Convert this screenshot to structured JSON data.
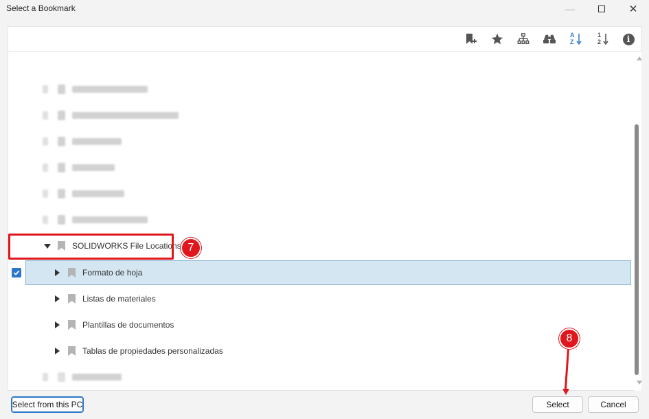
{
  "window": {
    "title": "Select a Bookmark",
    "minimize_label": "—",
    "close_label": "✕"
  },
  "toolbar": {
    "icons": [
      "add-bookmark-icon",
      "star-icon",
      "hierarchy-icon",
      "binoculars-icon",
      "sort-alpha-icon",
      "sort-numeric-icon",
      "info-icon"
    ],
    "sort_alpha_a": "A",
    "sort_alpha_z": "Z",
    "sort_num_1": "1",
    "sort_num_2": "2",
    "info_glyph": "i",
    "accent_color": "#3b7fd1"
  },
  "tree": {
    "group": {
      "label": "SOLIDWORKS File Locations",
      "expanded": true
    },
    "children": [
      {
        "label": "Formato de hoja",
        "selected": true,
        "checked": true
      },
      {
        "label": "Listas de materiales",
        "selected": false
      },
      {
        "label": "Plantillas de documentos",
        "selected": false
      },
      {
        "label": "Tablas de propiedades personalizadas",
        "selected": false
      }
    ]
  },
  "annotations": {
    "step_7": "7",
    "step_8": "8",
    "highlight_color": "#e0161d"
  },
  "footer": {
    "select_from_pc": "Select from this PC",
    "select": "Select",
    "cancel": "Cancel"
  }
}
